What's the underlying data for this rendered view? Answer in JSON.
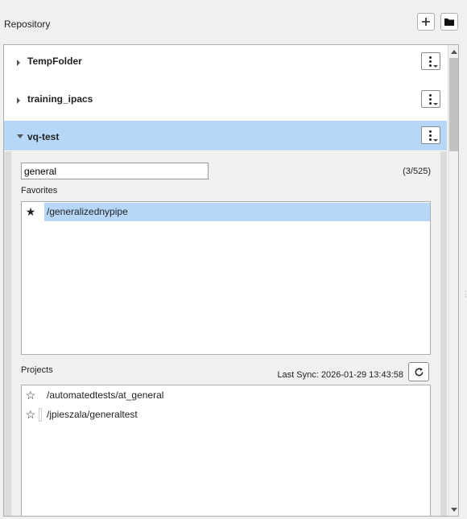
{
  "header": {
    "title": "Repository",
    "add_icon": "plus-icon",
    "folder_icon": "folder-icon"
  },
  "repositories": [
    {
      "name": "TempFolder",
      "expanded": false
    },
    {
      "name": "training_ipacs",
      "expanded": false
    },
    {
      "name": "vq-test",
      "expanded": true
    }
  ],
  "expanded_repo": {
    "search": {
      "value": "general",
      "placeholder": ""
    },
    "count": "(3/525)",
    "favorites": {
      "label": "Favorites",
      "items": [
        {
          "path": "/generalizednypipe",
          "starred": true,
          "selected": true
        }
      ]
    },
    "projects": {
      "label": "Projects",
      "last_sync": "Last Sync: 2026-01-29 13:43:58",
      "items": [
        {
          "path": "/automatedtests/at_general",
          "starred": false
        },
        {
          "path": "/jpieszala/generaltest",
          "starred": false
        }
      ]
    }
  },
  "colors": {
    "selection": "#b7d7f8",
    "background": "#f0f0f0"
  }
}
